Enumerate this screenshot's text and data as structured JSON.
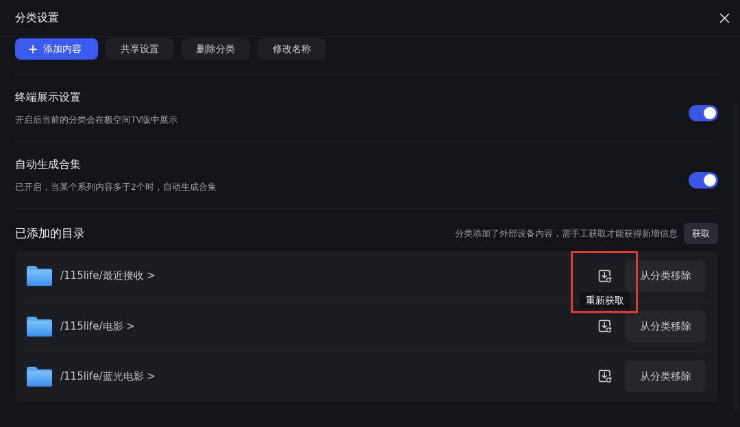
{
  "dialog": {
    "title": "分类设置"
  },
  "toolbar": [
    {
      "kind": "primary",
      "label": "添加内容"
    },
    {
      "kind": "secondary",
      "label": "共享设置"
    },
    {
      "kind": "secondary",
      "label": "删除分类"
    },
    {
      "kind": "secondary",
      "label": "修改名称"
    }
  ],
  "settings": [
    {
      "title": "终端展示设置",
      "description": "开启后当前的分类会在极空间TV版中展示",
      "on": true
    },
    {
      "title": "自动生成合集",
      "description": "已开启，当某个系列内容多于2个时，自动生成合集",
      "on": true
    }
  ],
  "directories": {
    "title": "已添加的目录",
    "notice": "分类添加了外部设备内容，需手工获取才能获得新增信息",
    "fetch_button": "获取",
    "items": [
      {
        "path": "/115life/最近接收 >",
        "remove_button": "从分类移除",
        "tooltip": "重新获取",
        "highlighted": true
      },
      {
        "path": "/115life/电影 >",
        "remove_button": "从分类移除",
        "highlighted": false
      },
      {
        "path": "/115life/蓝光电影 >",
        "remove_button": "从分类移除",
        "highlighted": false
      }
    ]
  }
}
